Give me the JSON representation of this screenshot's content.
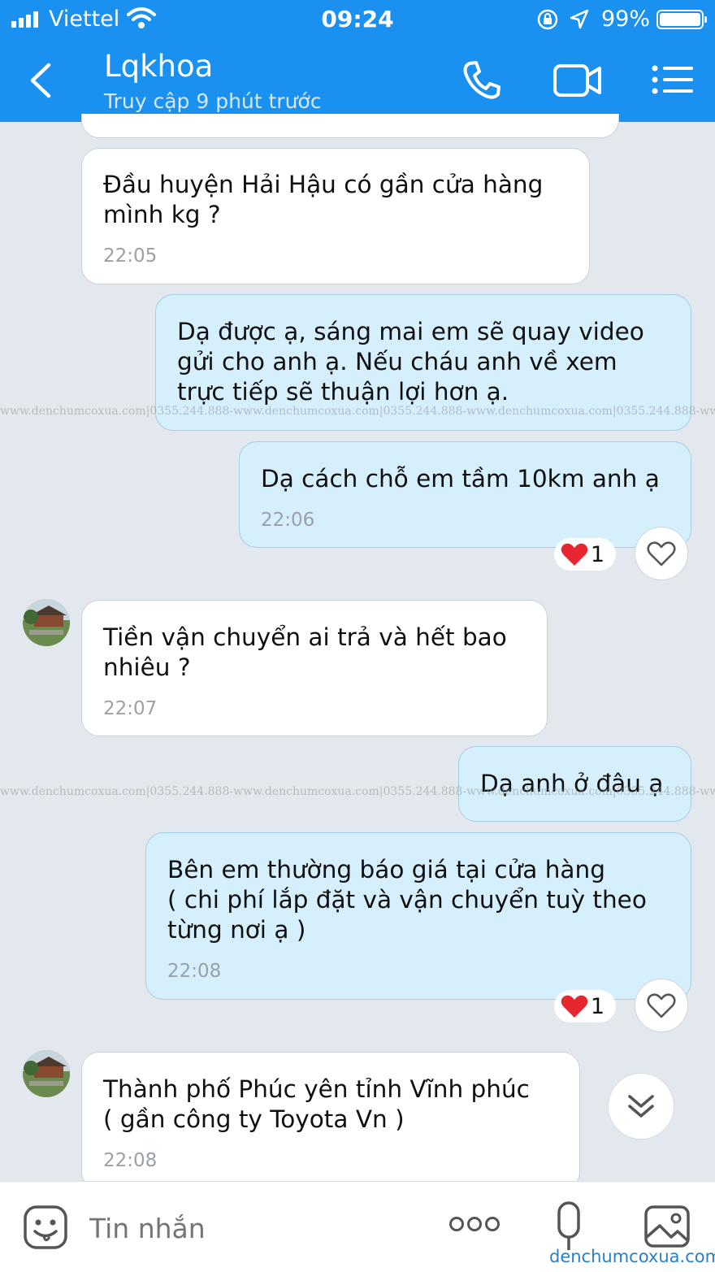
{
  "status_bar": {
    "carrier": "Viettel",
    "time": "09:24",
    "battery": "99%",
    "battery_level": 0.99
  },
  "header": {
    "name": "Lqkhoa",
    "status": "Truy cập 9 phút trước",
    "icons": [
      "back-icon",
      "phone-icon",
      "video-call-icon",
      "menu-list-icon"
    ],
    "background": "#1a90f0"
  },
  "messages": [
    {
      "direction": "in",
      "lines": [
        "Đầu huyện Hải Hậu có gần cửa hàng",
        "mình kg ?"
      ],
      "time": "22:05"
    },
    {
      "direction": "out",
      "lines": [
        "Dạ được ạ, sáng mai em sẽ quay video",
        "gửi cho anh ạ. Nếu cháu anh về xem",
        "trực tiếp sẽ thuận lợi hơn ạ."
      ],
      "time": ""
    },
    {
      "direction": "out",
      "lines": [
        "Dạ cách chỗ em tầm 10km anh ạ"
      ],
      "time": "22:06",
      "reaction": {
        "emoji": "heart",
        "count": "1"
      }
    },
    {
      "direction": "in",
      "lines": [
        "Tiền vận chuyển ai trả và hết bao",
        "nhiêu ?"
      ],
      "time": "22:07",
      "avatar": true
    },
    {
      "direction": "out",
      "lines": [
        "Dạ anh ở đâu ạ"
      ],
      "time": ""
    },
    {
      "direction": "out",
      "lines": [
        "Bên em thường báo giá tại cửa hàng",
        "( chi phí lắp đặt và vận chuyển tuỳ theo",
        "từng nơi ạ )"
      ],
      "time": "22:08",
      "reaction": {
        "emoji": "heart",
        "count": "1"
      }
    },
    {
      "direction": "in",
      "lines": [
        "Thành phố Phúc yên tỉnh Vĩnh phúc",
        "( gần công ty Toyota Vn )"
      ],
      "time": "22:08",
      "avatar": true
    }
  ],
  "watermark": "www.denchumcoxua.com|0355.244.888-www.denchumcoxua.com|0355.244.888-www.denchumcoxua.com|0355.244.888-www.denchumcoxua.com",
  "composer": {
    "placeholder": "Tin nhắn",
    "icons": [
      "sticker-icon",
      "more-icon",
      "microphone-icon",
      "gallery-icon"
    ]
  },
  "brand_watermark": "denchumcoxua.com",
  "colors": {
    "incoming_bubble": "#ffffff",
    "outgoing_bubble": "#d5effd",
    "chat_background": "#e3e8ef",
    "heart": "#e8262f"
  }
}
